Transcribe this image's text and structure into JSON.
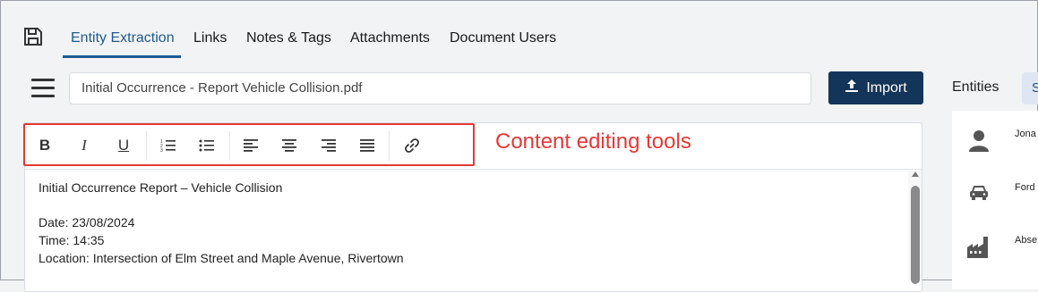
{
  "tabs": [
    {
      "label": "Entity Extraction",
      "active": true
    },
    {
      "label": "Links"
    },
    {
      "label": "Notes & Tags"
    },
    {
      "label": "Attachments"
    },
    {
      "label": "Document Users"
    }
  ],
  "document": {
    "filename": "Initial Occurrence - Report Vehicle Collision.pdf"
  },
  "import_button": {
    "label": "Import",
    "icon": "upload-icon"
  },
  "sidebar": {
    "title": "Entities",
    "tab_chip": "S",
    "entities": [
      {
        "icon": "person-icon",
        "name": "Jona"
      },
      {
        "icon": "car-icon",
        "name": "Ford"
      },
      {
        "icon": "factory-icon",
        "name": "Abse"
      }
    ]
  },
  "toolbar": {
    "bold": "B",
    "italic": "I",
    "underline": "U",
    "icons": [
      "bold-icon",
      "italic-icon",
      "underline-icon",
      "ordered-list-icon",
      "bullet-list-icon",
      "align-left-icon",
      "align-center-icon",
      "align-right-icon",
      "align-justify-icon",
      "link-icon"
    ]
  },
  "annotation": {
    "text": "Content editing tools",
    "color": "#e53935"
  },
  "content": {
    "heading": "Initial Occurrence Report – Vehicle Collision",
    "date": "Date: 23/08/2024",
    "time": "Time: 14:35",
    "location": "Location: Intersection of Elm Street and Maple Avenue, Rivertown"
  },
  "colors": {
    "accent": "#1f5a8f",
    "import_bg": "#13355a",
    "annotation": "#e53935"
  }
}
